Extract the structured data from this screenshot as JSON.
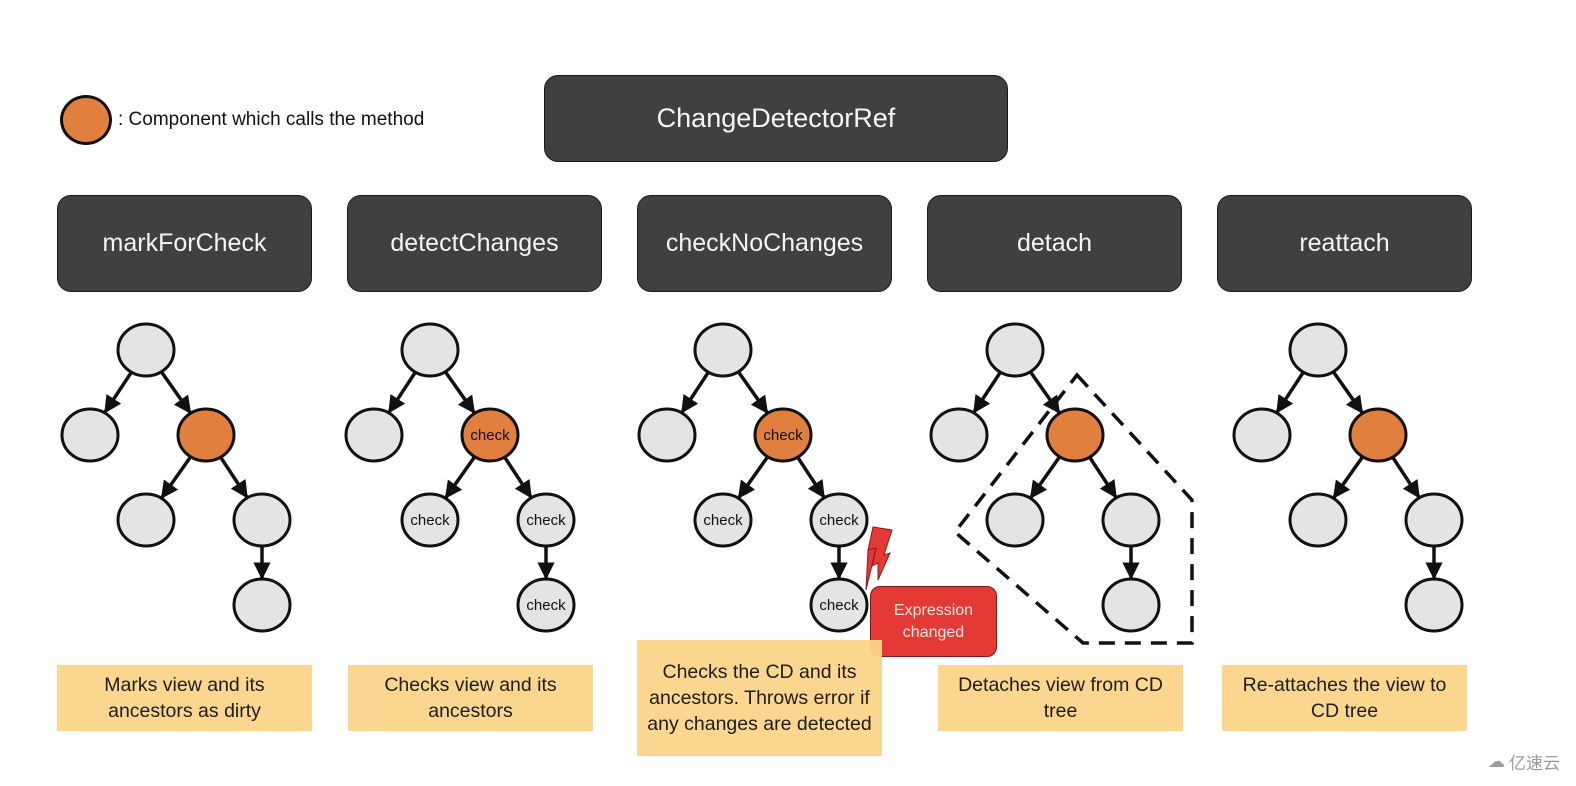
{
  "legend": {
    "text": ": Component which calls the method",
    "color": "#e07f3e"
  },
  "title": "ChangeDetectorRef",
  "colors": {
    "dark_box": "#404040",
    "node_fill": "#e4e4e4",
    "caller_fill": "#e07f3e",
    "desc_fill": "#fbd48a",
    "error_fill": "#e53935"
  },
  "methods": [
    {
      "name": "markForCheck",
      "description": "Marks view and its ancestors as dirty",
      "tree": {
        "nodes": [
          {
            "id": "root",
            "label": "",
            "caller": false
          },
          {
            "id": "left",
            "label": "",
            "caller": false
          },
          {
            "id": "caller",
            "label": "",
            "caller": true
          },
          {
            "id": "child-left",
            "label": "",
            "caller": false
          },
          {
            "id": "child-right",
            "label": "",
            "caller": false
          },
          {
            "id": "leaf",
            "label": "",
            "caller": false
          }
        ]
      }
    },
    {
      "name": "detectChanges",
      "description": "Checks view and its ancestors",
      "tree": {
        "nodes": [
          {
            "id": "root",
            "label": "",
            "caller": false
          },
          {
            "id": "left",
            "label": "",
            "caller": false
          },
          {
            "id": "caller",
            "label": "check",
            "caller": true
          },
          {
            "id": "child-left",
            "label": "check",
            "caller": false
          },
          {
            "id": "child-right",
            "label": "check",
            "caller": false
          },
          {
            "id": "leaf",
            "label": "check",
            "caller": false
          }
        ]
      }
    },
    {
      "name": "checkNoChanges",
      "description": "Checks the CD and its ancestors. Throws error if any changes are detected",
      "error_label": "Expression changed",
      "tree": {
        "nodes": [
          {
            "id": "root",
            "label": "",
            "caller": false
          },
          {
            "id": "left",
            "label": "",
            "caller": false
          },
          {
            "id": "caller",
            "label": "check",
            "caller": true
          },
          {
            "id": "child-left",
            "label": "check",
            "caller": false
          },
          {
            "id": "child-right",
            "label": "check",
            "caller": false
          },
          {
            "id": "leaf",
            "label": "check",
            "caller": false
          }
        ]
      }
    },
    {
      "name": "detach",
      "description": "Detaches view from CD tree",
      "detached_subtree": true,
      "tree": {
        "nodes": [
          {
            "id": "root",
            "label": "",
            "caller": false
          },
          {
            "id": "left",
            "label": "",
            "caller": false
          },
          {
            "id": "caller",
            "label": "",
            "caller": true
          },
          {
            "id": "child-left",
            "label": "",
            "caller": false
          },
          {
            "id": "child-right",
            "label": "",
            "caller": false
          },
          {
            "id": "leaf",
            "label": "",
            "caller": false
          }
        ]
      }
    },
    {
      "name": "reattach",
      "description": "Re-attaches the view to CD tree",
      "tree": {
        "nodes": [
          {
            "id": "root",
            "label": "",
            "caller": false
          },
          {
            "id": "left",
            "label": "",
            "caller": false
          },
          {
            "id": "caller",
            "label": "",
            "caller": true
          },
          {
            "id": "child-left",
            "label": "",
            "caller": false
          },
          {
            "id": "child-right",
            "label": "",
            "caller": false
          },
          {
            "id": "leaf",
            "label": "",
            "caller": false
          }
        ]
      }
    }
  ],
  "edges": [
    [
      "root",
      "left"
    ],
    [
      "root",
      "caller"
    ],
    [
      "caller",
      "child-left"
    ],
    [
      "caller",
      "child-right"
    ],
    [
      "child-right",
      "leaf"
    ]
  ],
  "watermark": "亿速云"
}
